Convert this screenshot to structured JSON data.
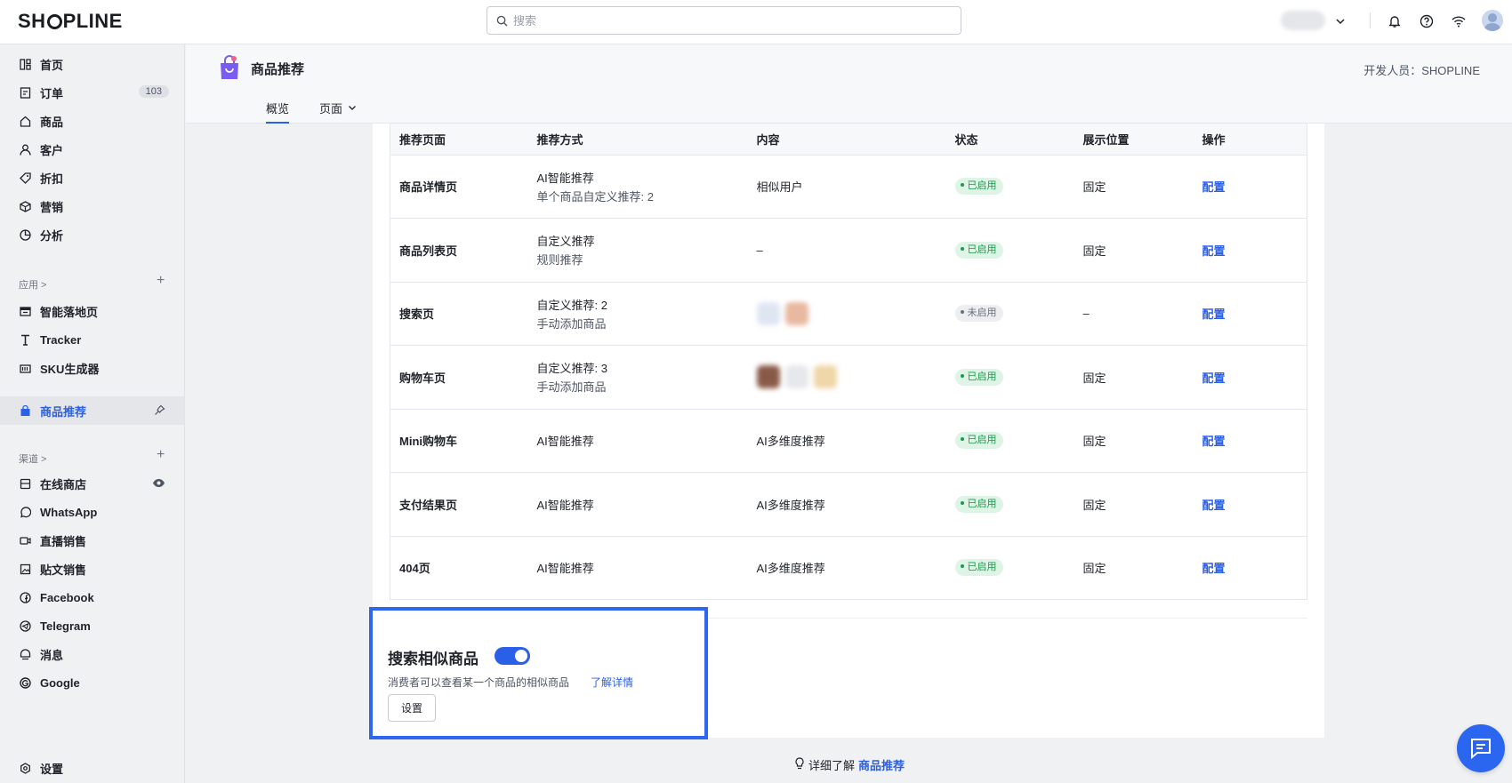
{
  "topbar": {
    "logo_pre": "SH",
    "logo_post": "PLINE",
    "search_placeholder": "搜索"
  },
  "sidebar": {
    "main_items": [
      {
        "label": "首页",
        "icon": "home-icon"
      },
      {
        "label": "订单",
        "icon": "order-icon",
        "badge": "103"
      },
      {
        "label": "商品",
        "icon": "bag-icon"
      },
      {
        "label": "客户",
        "icon": "user-icon"
      },
      {
        "label": "折扣",
        "icon": "tag-icon"
      },
      {
        "label": "营销",
        "icon": "box-icon"
      },
      {
        "label": "分析",
        "icon": "chart-icon"
      }
    ],
    "apps_label": "应用 >",
    "app_items": [
      {
        "label": "智能落地页",
        "icon": "landing-icon"
      },
      {
        "label": "Tracker",
        "icon": "tracker-icon"
      },
      {
        "label": "SKU生成器",
        "icon": "sku-icon"
      }
    ],
    "active_item": {
      "label": "商品推荐",
      "icon": "recommend-icon"
    },
    "channels_label": "渠道 >",
    "channel_items": [
      {
        "label": "在线商店",
        "icon": "store-icon"
      },
      {
        "label": "WhatsApp",
        "icon": "whatsapp-icon"
      },
      {
        "label": "直播销售",
        "icon": "live-icon"
      },
      {
        "label": "贴文销售",
        "icon": "post-icon"
      },
      {
        "label": "Facebook",
        "icon": "facebook-icon"
      },
      {
        "label": "Telegram",
        "icon": "telegram-icon"
      },
      {
        "label": "消息",
        "icon": "message-icon"
      },
      {
        "label": "Google",
        "icon": "google-icon"
      }
    ],
    "settings_label": "设置"
  },
  "app": {
    "title": "商品推荐",
    "developer": "开发人员：SHOPLINE",
    "tabs": [
      "概览",
      "页面"
    ]
  },
  "table": {
    "headers": [
      "推荐页面",
      "推荐方式",
      "内容",
      "状态",
      "展示位置",
      "操作"
    ],
    "rows": [
      {
        "page": "商品详情页",
        "method": "AI智能推荐",
        "method_sub": "单个商品自定义推荐: 2",
        "content": "相似用户",
        "status": "已启用",
        "position": "固定",
        "action": "配置"
      },
      {
        "page": "商品列表页",
        "method": "自定义推荐",
        "method_sub": "规则推荐",
        "content": "–",
        "status": "已启用",
        "position": "固定",
        "action": "配置"
      },
      {
        "page": "搜索页",
        "method": "自定义推荐: 2",
        "method_sub": "手动添加商品",
        "content": "",
        "status": "未启用",
        "position": "–",
        "action": "配置"
      },
      {
        "page": "购物车页",
        "method": "自定义推荐: 3",
        "method_sub": "手动添加商品",
        "content": "",
        "status": "已启用",
        "position": "固定",
        "action": "配置"
      },
      {
        "page": "Mini购物车",
        "method": "AI智能推荐",
        "method_sub": "",
        "content": "AI多维度推荐",
        "status": "已启用",
        "position": "固定",
        "action": "配置"
      },
      {
        "page": "支付结果页",
        "method": "AI智能推荐",
        "method_sub": "",
        "content": "AI多维度推荐",
        "status": "已启用",
        "position": "固定",
        "action": "配置"
      },
      {
        "page": "404页",
        "method": "AI智能推荐",
        "method_sub": "",
        "content": "AI多维度推荐",
        "status": "已启用",
        "position": "固定",
        "action": "配置"
      }
    ]
  },
  "feature": {
    "title": "搜索相似商品",
    "enabled": true,
    "desc": "消费者可以查看某一个商品的相似商品",
    "link": "了解详情",
    "button": "设置"
  },
  "footer": {
    "text": "详细了解",
    "link": "商品推荐"
  },
  "colors": {
    "accent": "#2a5fe8",
    "enabled": "#1a9a4a",
    "highlight_border": "#2f66f0"
  }
}
